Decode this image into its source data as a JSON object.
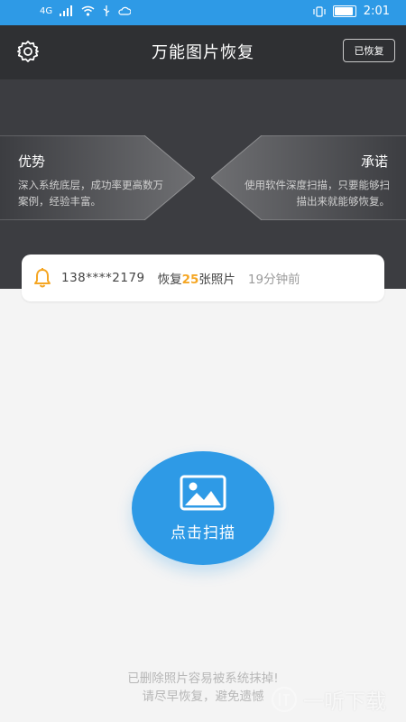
{
  "status_bar": {
    "network": "4G",
    "time": "2:01"
  },
  "header": {
    "title": "万能图片恢复",
    "restored_button": "已恢复",
    "settings_icon": "gear-icon"
  },
  "banner": {
    "advantage_title": "优势",
    "advantage_desc": "深入系统底层，成功率更高数万案例，经验丰富。",
    "promise_title": "承诺",
    "promise_desc": "使用软件深度扫描，只要能够扫描出来就能够恢复。"
  },
  "notice": {
    "phone": "138****2179",
    "restore_prefix": "恢复",
    "count": "25",
    "restore_suffix": "张照片",
    "time_ago": "19分钟前",
    "accent": "#f5a623"
  },
  "scan": {
    "label": "点击扫描",
    "icon": "image-icon",
    "color": "#2e9ae6"
  },
  "footer": {
    "line1": "已删除照片容易被系统抹掉!",
    "line2": "请尽早恢复，避免遗憾"
  },
  "watermark": {
    "text": "一听下载"
  }
}
